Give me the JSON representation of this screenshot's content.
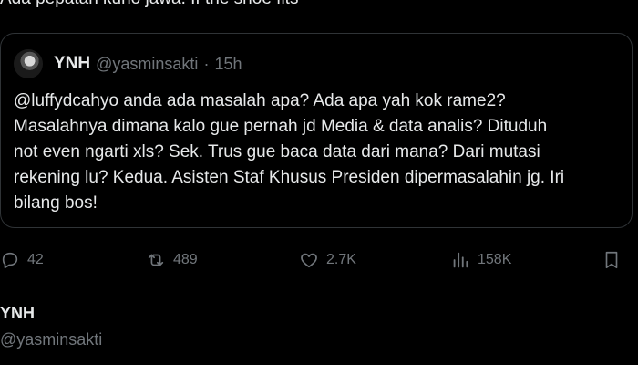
{
  "tweet": {
    "partial_text": "Ada pepatah kuno jawa. If the shoe fits~~"
  },
  "quote": {
    "author_name": "YNH",
    "author_handle": "@yasminsakti",
    "separator": "·",
    "timestamp": "15h",
    "lines": [
      "@luffydcahyo anda ada masalah apa? Ada apa yah kok rame2?",
      "Masalahnya dimana kalo gue pernah jd Media & data analis? Dituduh",
      "not even ngarti xls? Sek. Trus gue baca data dari mana? Dari mutasi",
      "rekening lu? Kedua. Asisten Staf Khusus Presiden dipermasalahin jg. Iri",
      "bilang bos!"
    ]
  },
  "actions": {
    "reply_count": "42",
    "repost_count": "489",
    "like_count": "2.7K",
    "views_count": "158K"
  },
  "next_author": {
    "name": "YNH",
    "handle": "@yasminsakti"
  },
  "colors": {
    "background": "#000000",
    "text": "#e7e9ea",
    "muted": "#71767b",
    "border": "#2f3336"
  }
}
